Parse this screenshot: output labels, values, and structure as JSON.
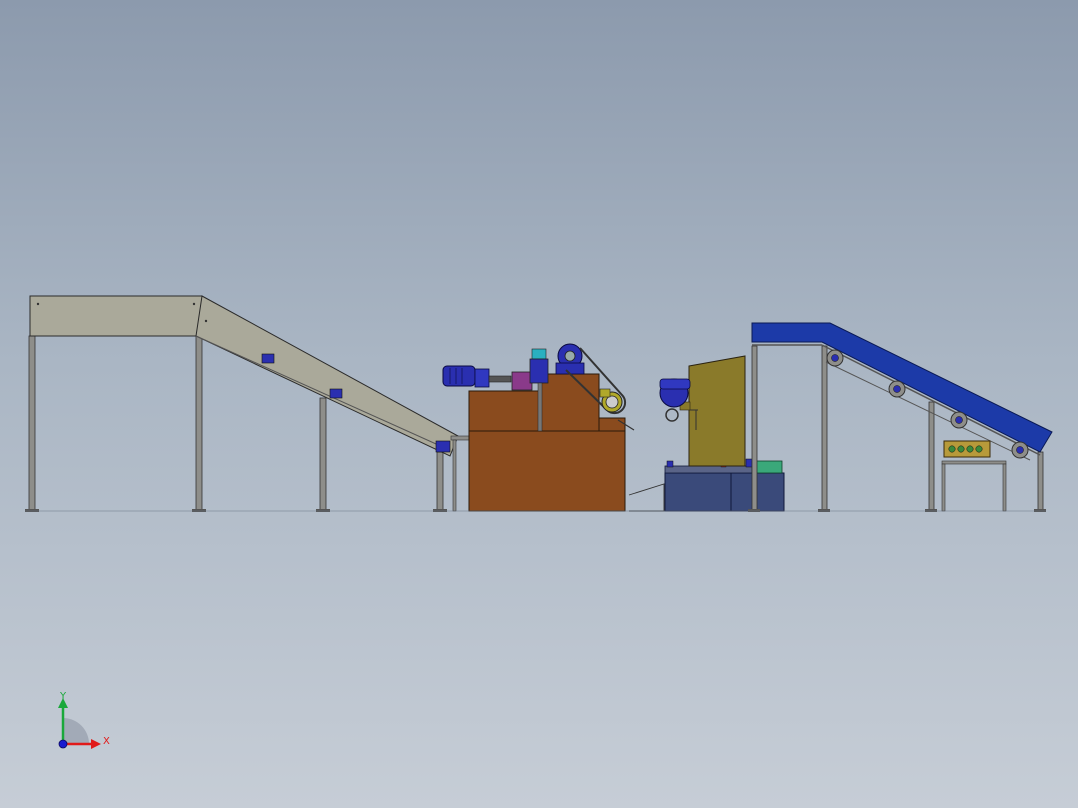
{
  "view": {
    "colors": {
      "background_top": "#8c9aad",
      "background_bottom": "#c6cdd6",
      "frame_steel": "#8e8e8a",
      "conveyor_grey": "#aaa99a",
      "cabinet_brown": "#8a4b1e",
      "motor_blue": "#2a2fb0",
      "base_navy": "#3a4a7a",
      "hopper_olive": "#8a7a2a",
      "belt_blue": "#1c3aa8",
      "control_box": "#b79a3a"
    }
  },
  "triad": {
    "x_label": "X",
    "y_label": "Y",
    "x_color": "#e11a1a",
    "y_color": "#1aa83a",
    "z_color": "#1a1ad0"
  }
}
